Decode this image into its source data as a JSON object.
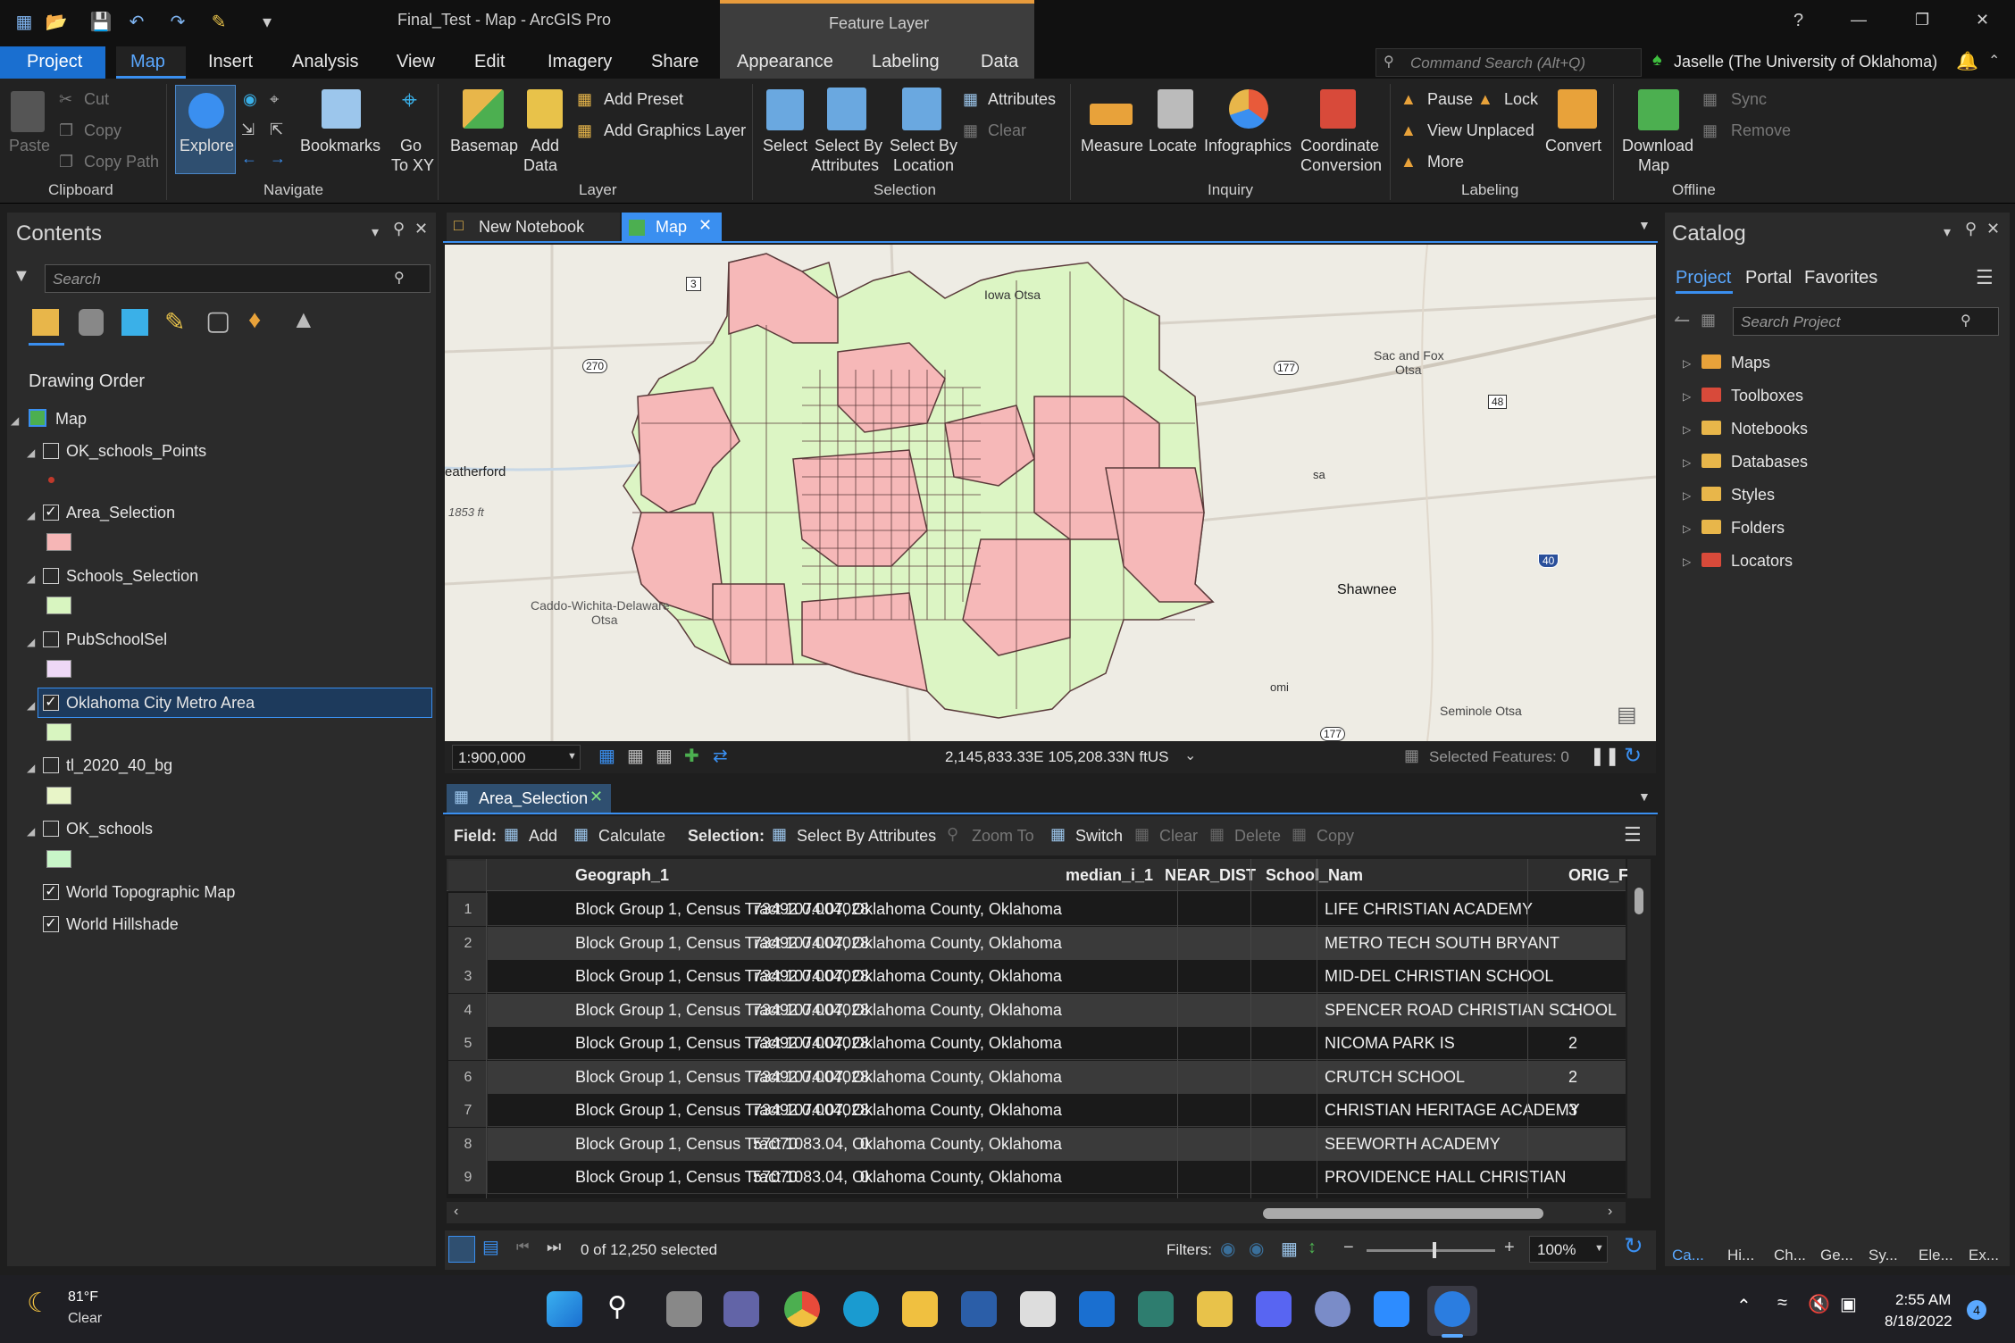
{
  "titlebar": {
    "doc_title": "Final_Test - Map - ArcGIS Pro",
    "contextual": "Feature Layer",
    "help": "?",
    "minimize": "—",
    "maximize": "❐",
    "close": "✕"
  },
  "tabs": [
    "Project",
    "Map",
    "Insert",
    "Analysis",
    "View",
    "Edit",
    "Imagery",
    "Share",
    "Appearance",
    "Labeling",
    "Data"
  ],
  "command_search": {
    "placeholder": "Command Search (Alt+Q)"
  },
  "user": "Jaselle (The University of Oklahoma)",
  "ribbon": {
    "clipboard": {
      "paste": "Paste",
      "cut": "Cut",
      "copy": "Copy",
      "copy_path": "Copy Path",
      "group": "Clipboard"
    },
    "navigate": {
      "explore": "Explore",
      "bookmarks": "Bookmarks",
      "go_to": "Go",
      "go_to2": "To XY",
      "group": "Navigate"
    },
    "layer": {
      "basemap": "Basemap",
      "add_data": "Add",
      "add_data2": "Data",
      "add_preset": "Add Preset",
      "add_graphics": "Add Graphics Layer",
      "group": "Layer"
    },
    "selection": {
      "select": "Select",
      "sel_attr": "Select By",
      "sel_attr2": "Attributes",
      "sel_loc": "Select By",
      "sel_loc2": "Location",
      "attributes": "Attributes",
      "clear": "Clear",
      "group": "Selection"
    },
    "inquiry": {
      "measure": "Measure",
      "locate": "Locate",
      "infographics": "Infographics",
      "coord": "Coordinate",
      "coord2": "Conversion",
      "group": "Inquiry"
    },
    "labeling": {
      "pause": "Pause",
      "lock": "Lock",
      "view_unplaced": "View Unplaced",
      "more": "More",
      "convert": "Convert",
      "group": "Labeling"
    },
    "offline": {
      "download": "Download",
      "download2": "Map",
      "sync": "Sync",
      "remove": "Remove",
      "group": "Offline"
    }
  },
  "contents": {
    "title": "Contents",
    "search_placeholder": "Search",
    "drawing_order": "Drawing Order",
    "map": "Map",
    "layers": [
      {
        "name": "OK_schools_Points",
        "checked": false,
        "symbol": "point",
        "color": "#c0392b"
      },
      {
        "name": "Area_Selection",
        "checked": true,
        "color": "#f6b6b6"
      },
      {
        "name": "Schools_Selection",
        "checked": false,
        "color": "#d8f5c0"
      },
      {
        "name": "PubSchoolSel",
        "checked": false,
        "color": "#eed8f6"
      },
      {
        "name": "Oklahoma City Metro Area",
        "checked": true,
        "color": "#d8f5c0",
        "selected": true
      },
      {
        "name": "tl_2020_40_bg",
        "checked": false,
        "color": "#e8f5c8"
      },
      {
        "name": "OK_schools",
        "checked": false,
        "color": "#c8f5c8"
      }
    ],
    "basemaps": [
      {
        "name": "World Topographic Map",
        "checked": true
      },
      {
        "name": "World Hillshade",
        "checked": true
      }
    ]
  },
  "views": {
    "tab_notebook": "New Notebook",
    "tab_map": "Map"
  },
  "map": {
    "labels": {
      "iowa": "Iowa Otsa",
      "sac": "Sac and Fox",
      "sac2": "Otsa",
      "weatherford": "eatherford",
      "elev": "1853 ft",
      "caddo": "Caddo-Wichita-Delaware",
      "caddo2": "Otsa",
      "shawnee": "Shawnee",
      "seminole": "Seminole Otsa",
      "sa": "sa",
      "omi": "omi"
    },
    "shields": {
      "s3": "3",
      "s270": "270",
      "s177": "177",
      "s48": "48",
      "s40": "40",
      "s177b": "177"
    },
    "colors": {
      "pink": "#f6b8b8",
      "green": "#dcf5c4",
      "boundary": "#5a3a3a"
    }
  },
  "map_status": {
    "scale": "1:900,000",
    "coords": "2,145,833.33E 105,208.33N ftUS",
    "selected": "Selected Features: 0"
  },
  "table": {
    "tab": "Area_Selection",
    "toolbar": {
      "field": "Field:",
      "add": "Add",
      "calculate": "Calculate",
      "selection": "Selection:",
      "sel_attr": "Select By Attributes",
      "zoom_to": "Zoom To",
      "switch": "Switch",
      "clear": "Clear",
      "delete": "Delete",
      "copy": "Copy"
    },
    "columns": [
      "Geograph_1",
      "median_i_1",
      "NEAR_DIST",
      "School_Nam",
      "ORIG_F"
    ],
    "rows": [
      {
        "n": "1",
        "geo": "Block Group 1, Census Tract 1074.07, Oklahoma County, Oklahoma",
        "median": "73492",
        "near": "0.004028",
        "school": "LIFE CHRISTIAN ACADEMY",
        "orig": ""
      },
      {
        "n": "2",
        "geo": "Block Group 1, Census Tract 1074.07, Oklahoma County, Oklahoma",
        "median": "73492",
        "near": "0.004028",
        "school": "METRO TECH SOUTH BRYANT CAMPUS",
        "orig": ""
      },
      {
        "n": "3",
        "geo": "Block Group 1, Census Tract 1074.07, Oklahoma County, Oklahoma",
        "median": "73492",
        "near": "0.004028",
        "school": "MID-DEL CHRISTIAN SCHOOL",
        "orig": ""
      },
      {
        "n": "4",
        "geo": "Block Group 1, Census Tract 1074.07, Oklahoma County, Oklahoma",
        "median": "73492",
        "near": "0.004028",
        "school": "SPENCER ROAD CHRISTIAN SCHOOL",
        "orig": "1"
      },
      {
        "n": "5",
        "geo": "Block Group 1, Census Tract 1074.07, Oklahoma County, Oklahoma",
        "median": "73492",
        "near": "0.004028",
        "school": "NICOMA PARK IS",
        "orig": "2"
      },
      {
        "n": "6",
        "geo": "Block Group 1, Census Tract 1074.07, Oklahoma County, Oklahoma",
        "median": "73492",
        "near": "0.004028",
        "school": "CRUTCH SCHOOL",
        "orig": "2"
      },
      {
        "n": "7",
        "geo": "Block Group 1, Census Tract 1074.07, Oklahoma County, Oklahoma",
        "median": "73492",
        "near": "0.004028",
        "school": "CHRISTIAN HERITAGE ACADEMY",
        "orig": "3"
      },
      {
        "n": "8",
        "geo": "Block Group 1, Census Tract 1083.04, Oklahoma County, Oklahoma",
        "median": "57070",
        "near": "0",
        "school": "SEEWORTH ACADEMY",
        "orig": ""
      },
      {
        "n": "9",
        "geo": "Block Group 1, Census Tract 1083.04, Oklahoma County, Oklahoma",
        "median": "57070",
        "near": "0",
        "school": "PROVIDENCE HALL CHRISTIAN SCHOOL",
        "orig": ""
      }
    ],
    "status": "0 of 12,250 selected",
    "filters": "Filters:",
    "zoom": "100%"
  },
  "catalog": {
    "title": "Catalog",
    "tabs": [
      "Project",
      "Portal",
      "Favorites"
    ],
    "search_placeholder": "Search Project",
    "items": [
      "Maps",
      "Toolboxes",
      "Notebooks",
      "Databases",
      "Styles",
      "Folders",
      "Locators"
    ],
    "bottom_tabs": [
      "Ca...",
      "Hi...",
      "Ch...",
      "Ge...",
      "Sy...",
      "Ele...",
      "Ex..."
    ]
  },
  "taskbar": {
    "temp": "81°F",
    "weather": "Clear",
    "time": "2:55 AM",
    "date": "8/18/2022",
    "badge": "4"
  }
}
